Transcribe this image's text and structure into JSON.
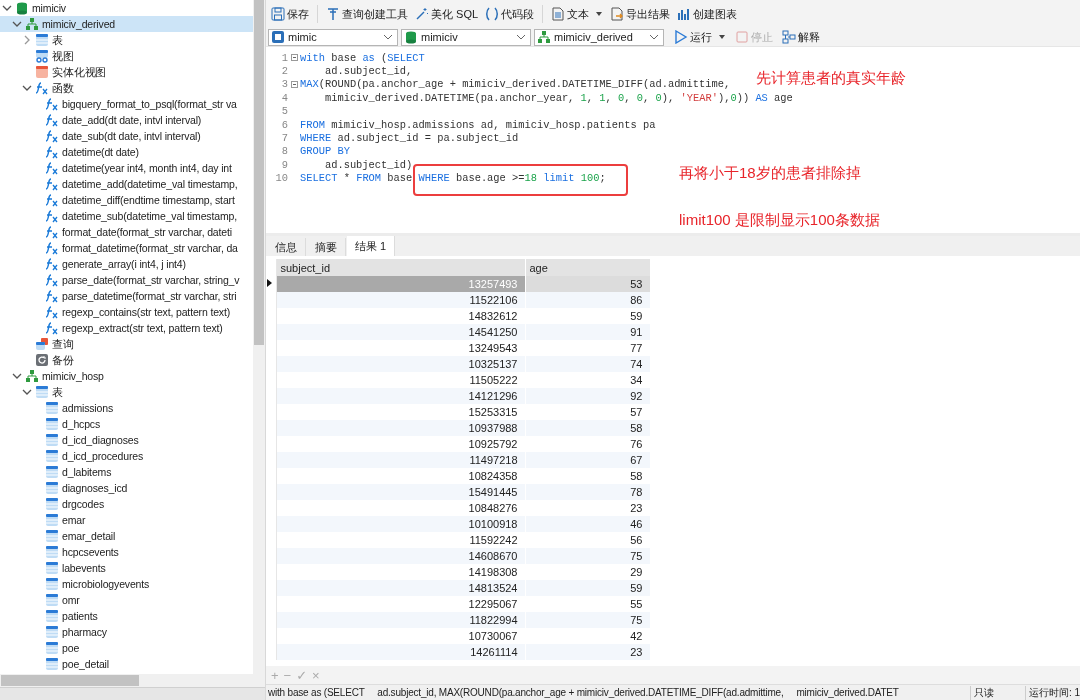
{
  "tree": [
    {
      "label": "mimiciv",
      "kind": "database",
      "expanded": true,
      "selected": false,
      "children": [
        {
          "label": "mimiciv_derived",
          "kind": "schema",
          "expanded": true,
          "selected": true,
          "children": [
            {
              "label": "表",
              "kind": "tables",
              "expanded": false,
              "selected": false
            },
            {
              "label": "视图",
              "kind": "views",
              "selected": false
            },
            {
              "label": "实体化视图",
              "kind": "matviews",
              "selected": false
            },
            {
              "label": "函数",
              "kind": "functions",
              "expanded": true,
              "selected": false,
              "children": [
                {
                  "label": "bigquery_format_to_psql(format_str va",
                  "kind": "function",
                  "selected": false
                },
                {
                  "label": "date_add(dt date, intvl interval)",
                  "kind": "function",
                  "selected": false
                },
                {
                  "label": "date_sub(dt date, intvl interval)",
                  "kind": "function",
                  "selected": false
                },
                {
                  "label": "datetime(dt date)",
                  "kind": "function",
                  "selected": false
                },
                {
                  "label": "datetime(year int4, month int4, day int",
                  "kind": "function",
                  "selected": false
                },
                {
                  "label": "datetime_add(datetime_val timestamp,",
                  "kind": "function",
                  "selected": false
                },
                {
                  "label": "datetime_diff(endtime timestamp, start",
                  "kind": "function",
                  "selected": false
                },
                {
                  "label": "datetime_sub(datetime_val timestamp,",
                  "kind": "function",
                  "selected": false
                },
                {
                  "label": "format_date(format_str varchar, dateti",
                  "kind": "function",
                  "selected": false
                },
                {
                  "label": "format_datetime(format_str varchar, da",
                  "kind": "function",
                  "selected": false
                },
                {
                  "label": "generate_array(i int4, j int4)",
                  "kind": "function",
                  "selected": false
                },
                {
                  "label": "parse_date(format_str varchar, string_v",
                  "kind": "function",
                  "selected": false
                },
                {
                  "label": "parse_datetime(format_str varchar, stri",
                  "kind": "function",
                  "selected": false
                },
                {
                  "label": "regexp_contains(str text, pattern text)",
                  "kind": "function",
                  "selected": false
                },
                {
                  "label": "regexp_extract(str text, pattern text)",
                  "kind": "function",
                  "selected": false
                }
              ]
            },
            {
              "label": "查询",
              "kind": "queries",
              "selected": false
            },
            {
              "label": "备份",
              "kind": "backups",
              "selected": false
            }
          ]
        },
        {
          "label": "mimiciv_hosp",
          "kind": "schema",
          "expanded": true,
          "selected": false,
          "children": [
            {
              "label": "表",
              "kind": "tables",
              "expanded": true,
              "selected": false,
              "children": [
                {
                  "label": "admissions",
                  "kind": "table",
                  "selected": false
                },
                {
                  "label": "d_hcpcs",
                  "kind": "table",
                  "selected": false
                },
                {
                  "label": "d_icd_diagnoses",
                  "kind": "table",
                  "selected": false
                },
                {
                  "label": "d_icd_procedures",
                  "kind": "table",
                  "selected": false
                },
                {
                  "label": "d_labitems",
                  "kind": "table",
                  "selected": false
                },
                {
                  "label": "diagnoses_icd",
                  "kind": "table",
                  "selected": false
                },
                {
                  "label": "drgcodes",
                  "kind": "table",
                  "selected": false
                },
                {
                  "label": "emar",
                  "kind": "table",
                  "selected": false
                },
                {
                  "label": "emar_detail",
                  "kind": "table",
                  "selected": false
                },
                {
                  "label": "hcpcsevents",
                  "kind": "table",
                  "selected": false
                },
                {
                  "label": "labevents",
                  "kind": "table",
                  "selected": false
                },
                {
                  "label": "microbiologyevents",
                  "kind": "table",
                  "selected": false
                },
                {
                  "label": "omr",
                  "kind": "table",
                  "selected": false
                },
                {
                  "label": "patients",
                  "kind": "table",
                  "selected": false
                },
                {
                  "label": "pharmacy",
                  "kind": "table",
                  "selected": false
                },
                {
                  "label": "poe",
                  "kind": "table",
                  "selected": false
                },
                {
                  "label": "poe_detail",
                  "kind": "table",
                  "selected": false
                }
              ]
            }
          ]
        }
      ]
    }
  ],
  "toolbar": [
    {
      "label": "保存",
      "kind": "save"
    },
    {
      "label": "查询创建工具",
      "kind": "builder"
    },
    {
      "label": "美化 SQL",
      "kind": "beautify"
    },
    {
      "label": "代码段",
      "kind": "snippet"
    },
    {
      "label": "文本",
      "kind": "text",
      "dropdown": true
    },
    {
      "label": "导出结果",
      "kind": "export"
    },
    {
      "label": "创建图表",
      "kind": "chart"
    }
  ],
  "selectors": [
    {
      "value": "mimic",
      "kind": "connection"
    },
    {
      "value": "mimiciv",
      "kind": "database"
    },
    {
      "value": "mimiciv_derived",
      "kind": "schema"
    }
  ],
  "run_controls": [
    {
      "label": "运行",
      "kind": "run",
      "dropdown": true,
      "disabled": false
    },
    {
      "label": "停止",
      "kind": "stop",
      "disabled": true
    },
    {
      "label": "解释",
      "kind": "explain",
      "disabled": false
    }
  ],
  "editor": {
    "lines": [
      {
        "number": "1",
        "fold": true,
        "tokens": [
          {
            "text": "with",
            "kind": "keyword"
          },
          {
            "text": " base ",
            "kind": "plain"
          },
          {
            "text": "as",
            "kind": "keyword"
          },
          {
            "text": " (",
            "kind": "plain"
          },
          {
            "text": "SELECT",
            "kind": "keyword"
          }
        ]
      },
      {
        "number": "2",
        "fold": false,
        "tokens": [
          {
            "text": "    ad.subject_id,",
            "kind": "plain"
          }
        ]
      },
      {
        "number": "3",
        "fold": true,
        "tokens": [
          {
            "text": "MAX",
            "kind": "keyword"
          },
          {
            "text": "(ROUND(pa.anchor_age + mimiciv_derived.DATETIME_DIFF(ad.admittime,",
            "kind": "plain"
          }
        ]
      },
      {
        "number": "4",
        "fold": false,
        "tokens": [
          {
            "text": "    mimiciv_derived.DATETIME(pa.anchor_year, ",
            "kind": "plain"
          },
          {
            "text": "1",
            "kind": "number"
          },
          {
            "text": ", ",
            "kind": "plain"
          },
          {
            "text": "1",
            "kind": "number"
          },
          {
            "text": ", ",
            "kind": "plain"
          },
          {
            "text": "0",
            "kind": "number"
          },
          {
            "text": ", ",
            "kind": "plain"
          },
          {
            "text": "0",
            "kind": "number"
          },
          {
            "text": ", ",
            "kind": "plain"
          },
          {
            "text": "0",
            "kind": "number"
          },
          {
            "text": "), ",
            "kind": "plain"
          },
          {
            "text": "'YEAR'",
            "kind": "string"
          },
          {
            "text": "),",
            "kind": "plain"
          },
          {
            "text": "0",
            "kind": "number"
          },
          {
            "text": ")) ",
            "kind": "plain"
          },
          {
            "text": "AS",
            "kind": "keyword"
          },
          {
            "text": " age",
            "kind": "plain"
          }
        ]
      },
      {
        "number": "5",
        "fold": false
      },
      {
        "number": "6",
        "fold": false,
        "tokens": [
          {
            "text": "FROM",
            "kind": "keyword"
          },
          {
            "text": " mimiciv_hosp.admissions ad, mimiciv_hosp.patients pa",
            "kind": "plain"
          }
        ]
      },
      {
        "number": "7",
        "fold": false,
        "tokens": [
          {
            "text": "WHERE",
            "kind": "keyword"
          },
          {
            "text": " ad.subject_id = pa.subject_id",
            "kind": "plain"
          }
        ]
      },
      {
        "number": "8",
        "fold": false,
        "tokens": [
          {
            "text": "GROUP BY",
            "kind": "keyword"
          }
        ]
      },
      {
        "number": "9",
        "fold": false,
        "tokens": [
          {
            "text": "    ad.subject_id)",
            "kind": "plain"
          }
        ]
      },
      {
        "number": "10",
        "fold": false,
        "tokens": [
          {
            "text": "SELECT",
            "kind": "keyword"
          },
          {
            "text": " * ",
            "kind": "plain"
          },
          {
            "text": "FROM",
            "kind": "keyword"
          },
          {
            "text": " base ",
            "kind": "plain"
          },
          {
            "text": "WHERE",
            "kind": "keyword"
          },
          {
            "text": " base.age >=",
            "kind": "plain"
          },
          {
            "text": "18",
            "kind": "number"
          },
          {
            "text": " limit",
            "kind": "keyword"
          },
          {
            "text": " 100",
            "kind": "number"
          },
          {
            "text": ";",
            "kind": "plain"
          }
        ]
      }
    ],
    "annotations": [
      "先计算患者的真实年龄",
      "再将小于18岁的患者排除掉",
      "limit100 是限制显示100条数据"
    ]
  },
  "result_tabs": [
    {
      "label": "信息",
      "selected": false
    },
    {
      "label": "摘要",
      "selected": false
    },
    {
      "label": "结果 1",
      "selected": true
    }
  ],
  "table": {
    "columns": [
      "subject_id",
      "age"
    ],
    "rows": [
      {
        "cells": [
          "13257493",
          "53"
        ],
        "selected": true
      },
      {
        "cells": [
          "11522106",
          "86"
        ],
        "selected": false
      },
      {
        "cells": [
          "14832612",
          "59"
        ],
        "selected": false
      },
      {
        "cells": [
          "14541250",
          "91"
        ],
        "selected": false
      },
      {
        "cells": [
          "13249543",
          "77"
        ],
        "selected": false
      },
      {
        "cells": [
          "10325137",
          "74"
        ],
        "selected": false
      },
      {
        "cells": [
          "11505222",
          "34"
        ],
        "selected": false
      },
      {
        "cells": [
          "14121296",
          "92"
        ],
        "selected": false
      },
      {
        "cells": [
          "15253315",
          "57"
        ],
        "selected": false
      },
      {
        "cells": [
          "10937988",
          "58"
        ],
        "selected": false
      },
      {
        "cells": [
          "10925792",
          "76"
        ],
        "selected": false
      },
      {
        "cells": [
          "11497218",
          "67"
        ],
        "selected": false
      },
      {
        "cells": [
          "10824358",
          "58"
        ],
        "selected": false
      },
      {
        "cells": [
          "15491445",
          "78"
        ],
        "selected": false
      },
      {
        "cells": [
          "10848276",
          "23"
        ],
        "selected": false
      },
      {
        "cells": [
          "10100918",
          "46"
        ],
        "selected": false
      },
      {
        "cells": [
          "11592242",
          "56"
        ],
        "selected": false
      },
      {
        "cells": [
          "14608670",
          "75"
        ],
        "selected": false
      },
      {
        "cells": [
          "14198308",
          "29"
        ],
        "selected": false
      },
      {
        "cells": [
          "14813524",
          "59"
        ],
        "selected": false
      },
      {
        "cells": [
          "12295067",
          "55"
        ],
        "selected": false
      },
      {
        "cells": [
          "11822994",
          "75"
        ],
        "selected": false
      },
      {
        "cells": [
          "10730067",
          "42"
        ],
        "selected": false
      },
      {
        "cells": [
          "14261114",
          "23"
        ],
        "selected": false
      }
    ]
  },
  "grid_actions": [
    "+",
    "−",
    "✓",
    "×"
  ],
  "status_bar": {
    "query": "with base as (SELECT     ad.subject_id, MAX(ROUND(pa.anchor_age + mimiciv_derived.DATETIME_DIFF(ad.admittime,     mimiciv_derived.DATET",
    "mode": "只读",
    "time": "运行时间: 1"
  }
}
